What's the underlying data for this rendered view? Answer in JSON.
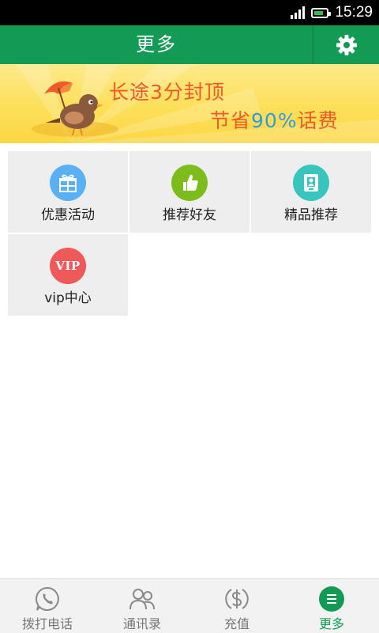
{
  "status_bar": {
    "time": "15:29",
    "battery_level": 0.8
  },
  "header": {
    "title": "更多",
    "settings_icon": "gear-icon"
  },
  "banner": {
    "line1": "长途3分封顶",
    "line2_prefix": "节省",
    "line2_highlight": "90%",
    "line2_suffix": "话费",
    "image": "bird-with-umbrella-illustration"
  },
  "grid": {
    "items": [
      {
        "label": "优惠活动",
        "icon": "gift-icon",
        "color": "#5ab0f4"
      },
      {
        "label": "推荐好友",
        "icon": "thumbs-up-icon",
        "color": "#7cbd1b"
      },
      {
        "label": "精品推荐",
        "icon": "apps-icon",
        "color": "#38c5bd"
      },
      {
        "label": "vip中心",
        "icon": "vip-icon",
        "icon_text": "VIP",
        "color": "#f0595a"
      }
    ]
  },
  "bottom_nav": {
    "active": "更多",
    "items": [
      {
        "label": "拨打电话",
        "icon": "phone-icon"
      },
      {
        "label": "通讯录",
        "icon": "contacts-icon"
      },
      {
        "label": "充值",
        "icon": "dollar-icon"
      },
      {
        "label": "更多",
        "icon": "menu-icon"
      }
    ]
  },
  "colors": {
    "primary": "#139b55",
    "banner_text": "#f05a28",
    "banner_highlight": "#2d9be6",
    "tile_bg": "#eeeeef"
  }
}
